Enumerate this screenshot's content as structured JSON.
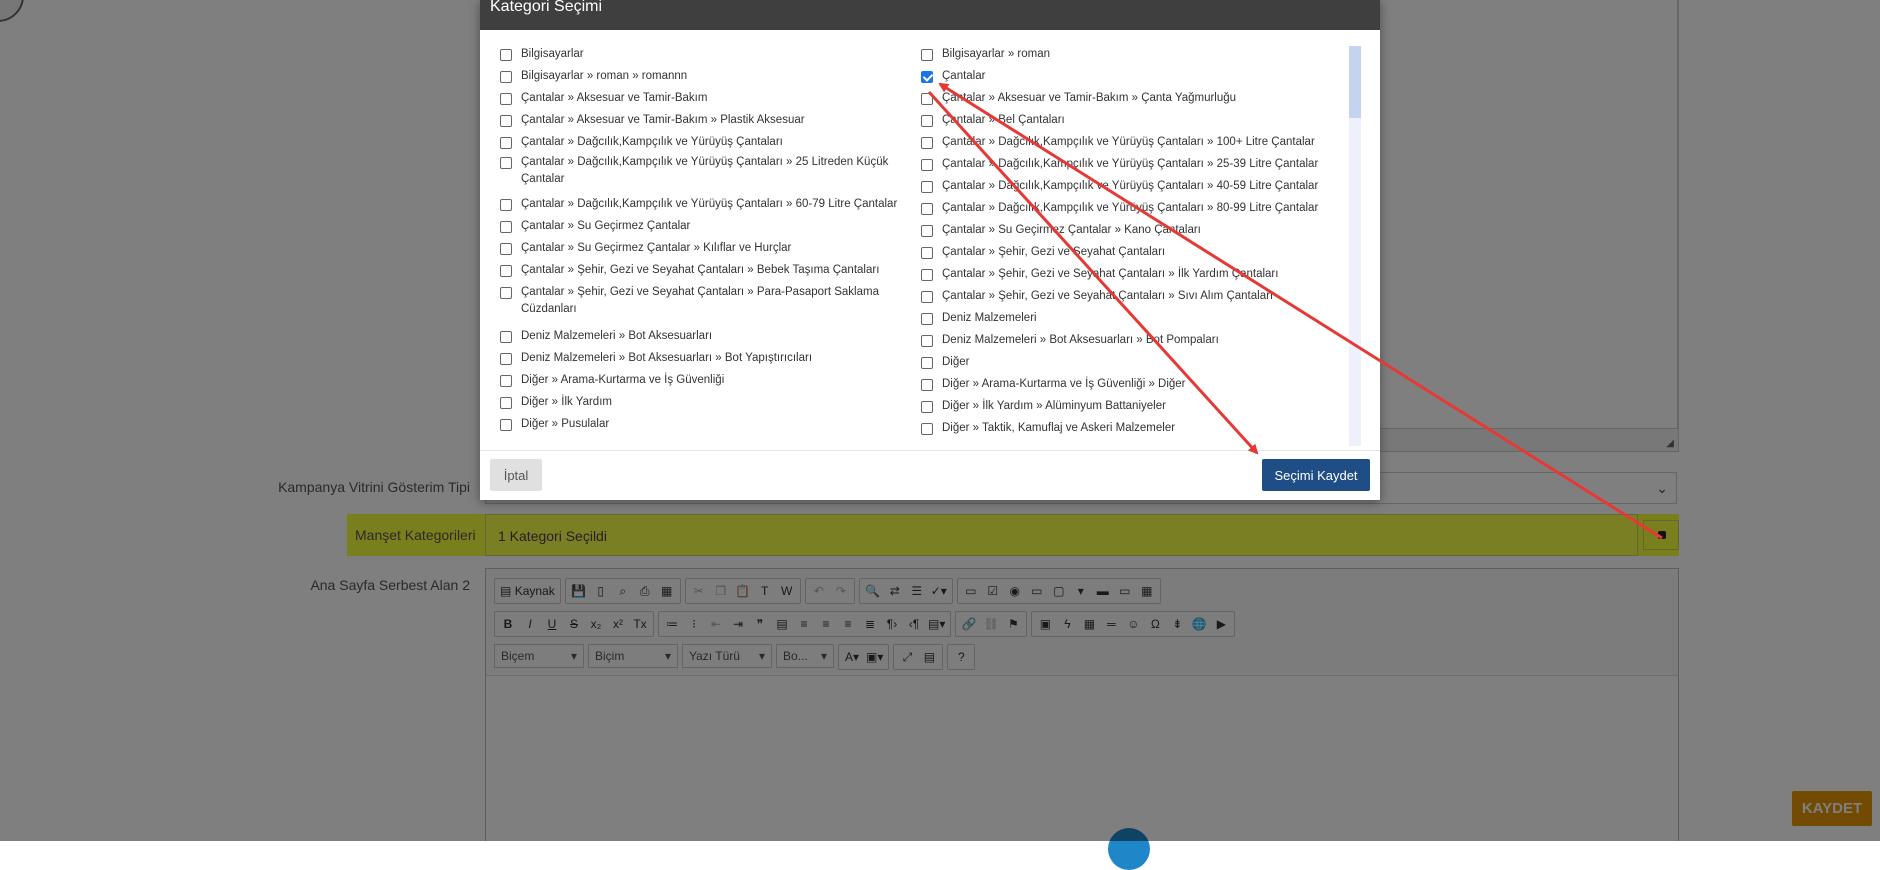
{
  "form": {
    "kampanya_label": "Kampanya Vitrini Gösterim Tipi",
    "manset_label": "Manşet Kategorileri",
    "manset_value": "1 Kategori Seçildi",
    "anasayfa_label": "Ana Sayfa Serbest Alan 2",
    "kaydet_label": "KAYDET"
  },
  "editor": {
    "kaynak_label": "Kaynak",
    "bicim1": "Biçem",
    "bicim2": "Biçim",
    "yazi_turu": "Yazı Türü",
    "boyut": "Bo...",
    "help": "?"
  },
  "modal": {
    "title": "Kategori Seçimi",
    "cancel_label": "İptal",
    "save_label": "Seçimi Kaydet",
    "left_items": [
      {
        "label": "Bilgisayarlar",
        "checked": false
      },
      {
        "label": "Bilgisayarlar » roman » romannn",
        "checked": false
      },
      {
        "label": "Çantalar » Aksesuar ve Tamir-Bakım",
        "checked": false
      },
      {
        "label": "Çantalar » Aksesuar ve Tamir-Bakım » Plastik Aksesuar",
        "checked": false
      },
      {
        "label": "Çantalar » Dağcılık,Kampçılık ve Yürüyüş Çantaları",
        "checked": false
      },
      {
        "label": "Çantalar » Dağcılık,Kampçılık ve Yürüyüş Çantaları » 25 Litreden Küçük Çantalar",
        "checked": false
      },
      {
        "label": "Çantalar » Dağcılık,Kampçılık ve Yürüyüş Çantaları » 60-79 Litre Çantalar",
        "checked": false
      },
      {
        "label": "Çantalar » Su Geçirmez Çantalar",
        "checked": false
      },
      {
        "label": "Çantalar » Su Geçirmez Çantalar » Kılıflar ve Hurçlar",
        "checked": false
      },
      {
        "label": "Çantalar » Şehir, Gezi ve Seyahat Çantaları » Bebek Taşıma Çantaları",
        "checked": false
      },
      {
        "label": "Çantalar » Şehir, Gezi ve Seyahat Çantaları » Para-Pasaport Saklama Cüzdanları",
        "checked": false
      },
      {
        "label": "Deniz Malzemeleri » Bot Aksesuarları",
        "checked": false
      },
      {
        "label": "Deniz Malzemeleri » Bot Aksesuarları » Bot Yapıştırıcıları",
        "checked": false
      },
      {
        "label": "Diğer » Arama-Kurtarma ve İş Güvenliği",
        "checked": false
      },
      {
        "label": "Diğer » İlk Yardım",
        "checked": false
      },
      {
        "label": "Diğer » Pusulalar",
        "checked": false
      }
    ],
    "right_items": [
      {
        "label": "Bilgisayarlar » roman",
        "checked": false
      },
      {
        "label": "Çantalar",
        "checked": true
      },
      {
        "label": "Çantalar » Aksesuar ve Tamir-Bakım » Çanta Yağmurluğu",
        "checked": false
      },
      {
        "label": "Çantalar » Bel Çantaları",
        "checked": false
      },
      {
        "label": "Çantalar » Dağcılık,Kampçılık ve Yürüyüş Çantaları » 100+ Litre Çantalar",
        "checked": false
      },
      {
        "label": "Çantalar » Dağcılık,Kampçılık ve Yürüyüş Çantaları » 25-39 Litre Çantalar",
        "checked": false
      },
      {
        "label": "Çantalar » Dağcılık,Kampçılık ve Yürüyüş Çantaları » 40-59 Litre Çantalar",
        "checked": false
      },
      {
        "label": "Çantalar » Dağcılık,Kampçılık ve Yürüyüş Çantaları » 80-99 Litre Çantalar",
        "checked": false
      },
      {
        "label": "Çantalar » Su Geçirmez Çantalar » Kano Çantaları",
        "checked": false
      },
      {
        "label": "Çantalar » Şehir, Gezi ve Seyahat Çantaları",
        "checked": false
      },
      {
        "label": "Çantalar » Şehir, Gezi ve Seyahat Çantaları » İlk Yardım Çantaları",
        "checked": false
      },
      {
        "label": "Çantalar » Şehir, Gezi ve Seyahat Çantaları » Sıvı Alım Çantaları",
        "checked": false
      },
      {
        "label": "Deniz Malzemeleri",
        "checked": false
      },
      {
        "label": "Deniz Malzemeleri » Bot Aksesuarları » Bot Pompaları",
        "checked": false
      },
      {
        "label": "Diğer",
        "checked": false
      },
      {
        "label": "Diğer » Arama-Kurtarma ve İş Güvenliği » Diğer",
        "checked": false
      },
      {
        "label": "Diğer » İlk Yardım » Alüminyum Battaniyeler",
        "checked": false
      },
      {
        "label": "Diğer » Taktik, Kamuflaj ve Askeri Malzemeler",
        "checked": false
      }
    ]
  },
  "colors": {
    "annotation_arrow": "#e53935",
    "highlight": "#f4ff3a",
    "primary_button": "#1f4e87",
    "save_button": "#e59500"
  }
}
